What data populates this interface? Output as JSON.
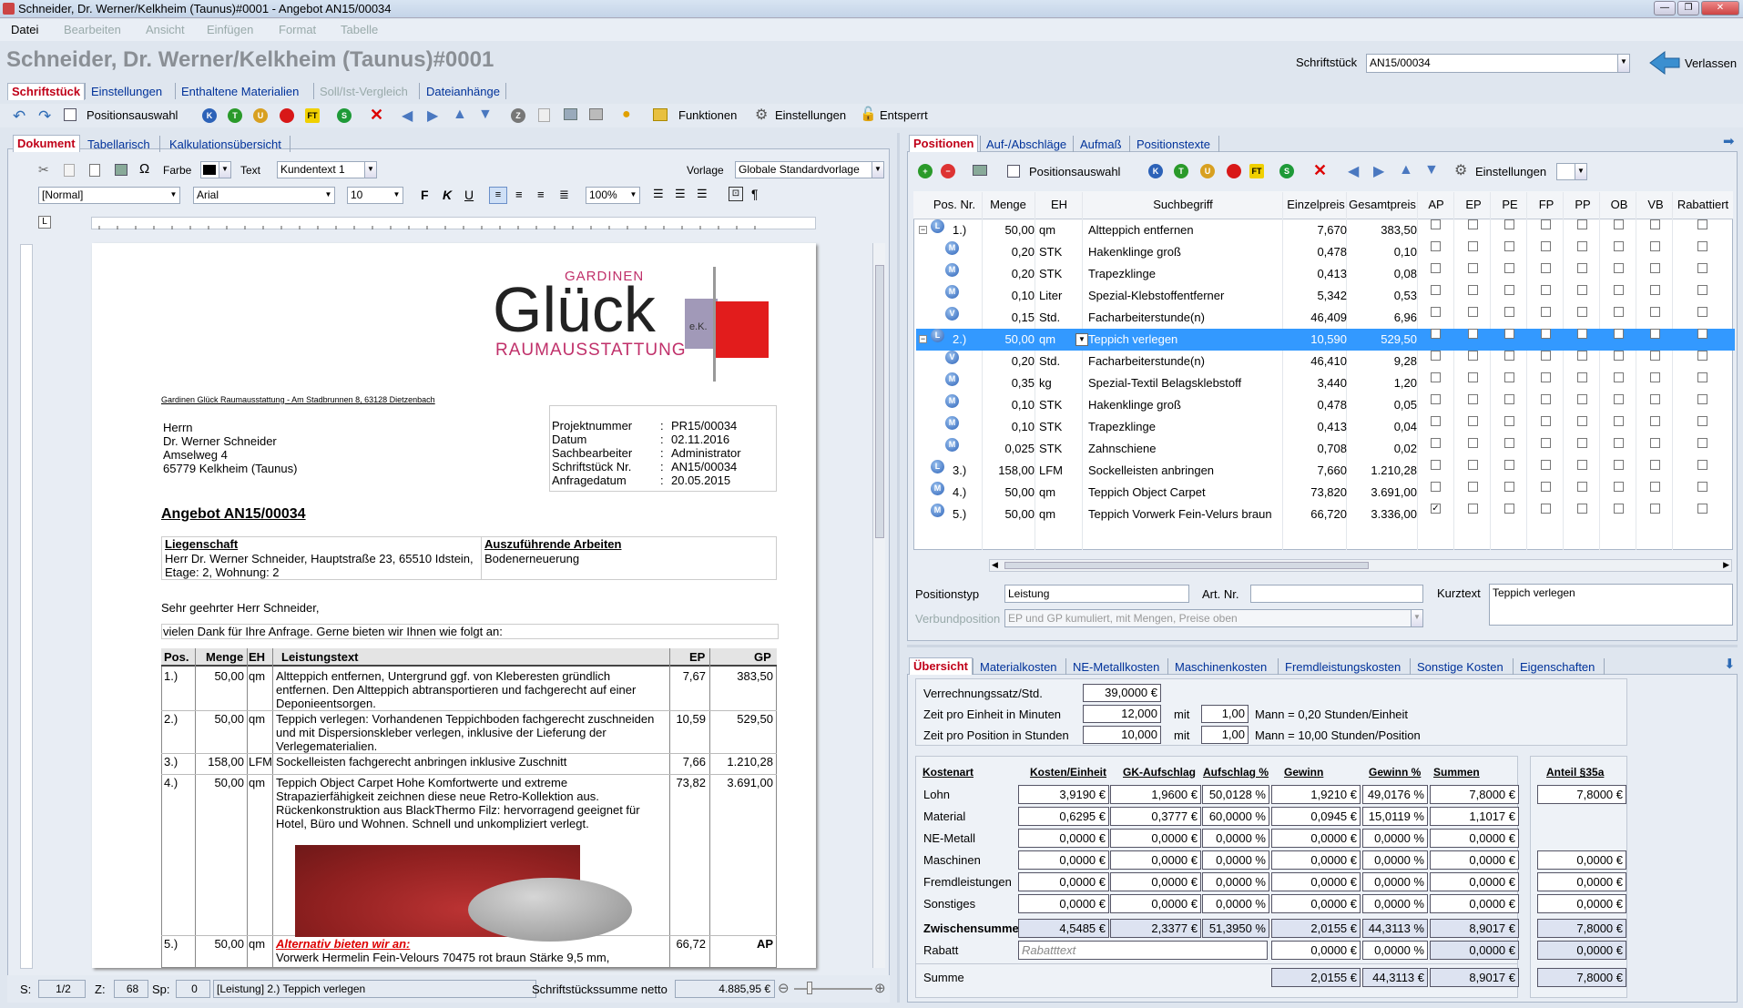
{
  "window": {
    "title": "Schneider, Dr. Werner/Kelkheim (Taunus)#0001 - Angebot AN15/00034"
  },
  "menu": [
    "Datei",
    "Bearbeiten",
    "Ansicht",
    "Einfügen",
    "Format",
    "Tabelle"
  ],
  "header": {
    "title": "Schneider, Dr. Werner/Kelkheim (Taunus)#0001",
    "schriftstueck_label": "Schriftstück",
    "schriftstueck_value": "AN15/00034",
    "verlassen": "Verlassen"
  },
  "main_tabs": [
    "Schriftstück",
    "Einstellungen",
    "Enthaltene Materialien",
    "Soll/Ist-Vergleich",
    "Dateianhänge"
  ],
  "toolbar": {
    "positionsauswahl": "Positionsauswahl",
    "funktionen": "Funktionen",
    "einstellungen": "Einstellungen",
    "entsperrt": "Entsperrt"
  },
  "doc_tabs": [
    "Dokument",
    "Tabellarisch",
    "Kalkulationsübersicht"
  ],
  "format": {
    "farbe": "Farbe",
    "text": "Text",
    "text_style": "Kundentext 1",
    "vorlage_label": "Vorlage",
    "vorlage": "Globale Standardvorlage",
    "style": "[Normal]",
    "font": "Arial",
    "size": "10",
    "zoom": "100%"
  },
  "document": {
    "logo_top": "GARDINEN",
    "logo_main": "Glück",
    "logo_ek": "e.K.",
    "logo_sub": "RAUMAUSSTATTUNG",
    "sender": "Gardinen Glück Raumausstattung - Am Stadbrunnen 8, 63128 Dietzenbach",
    "address": [
      "Herrn",
      "Dr. Werner Schneider",
      "Amselweg 4",
      "65779 Kelkheim (Taunus)"
    ],
    "meta_labels": [
      "Projektnummer",
      "Datum",
      "Sachbearbeiter",
      "Schriftstück Nr.",
      "Anfragedatum"
    ],
    "meta_values": [
      "PR15/00034",
      "02.11.2016",
      "Administrator",
      "AN15/00034",
      "20.05.2015"
    ],
    "heading": "Angebot AN15/00034",
    "liegenschaft_label": "Liegenschaft",
    "liegenschaft": "Herr Dr. Werner Schneider, Hauptstraße 23, 65510 Idstein, Etage: 2, Wohnung: 2",
    "arbeiten_label": "Auszuführende Arbeiten",
    "arbeiten": "Bodenerneuerung",
    "greeting": "Sehr geehrter Herr Schneider,",
    "intro": "vielen Dank für Ihre Anfrage. Gerne bieten wir Ihnen wie folgt an:",
    "cols": [
      "Pos.",
      "Menge",
      "EH",
      "Leistungstext",
      "EP",
      "GP"
    ],
    "rows": [
      {
        "pos": "1.)",
        "menge": "50,00",
        "eh": "qm",
        "text": "Altteppich entfernen, Untergrund ggf. von Kleberesten gründlich entfernen. Den Altteppich abtransportieren und fachgerecht auf einer Deponieentsorgen.",
        "ep": "7,67",
        "gp": "383,50"
      },
      {
        "pos": "2.)",
        "menge": "50,00",
        "eh": "qm",
        "text": "Teppich verlegen: Vorhandenen Teppichboden fachgerecht zuschneiden und mit Dispersionskleber verlegen, inklusive der Lieferung der Verlegematerialien.",
        "ep": "10,59",
        "gp": "529,50"
      },
      {
        "pos": "3.)",
        "menge": "158,00",
        "eh": "LFM",
        "text": "Sockelleisten fachgerecht anbringen inklusive Zuschnitt",
        "ep": "7,66",
        "gp": "1.210,28"
      },
      {
        "pos": "4.)",
        "menge": "50,00",
        "eh": "qm",
        "text": "Teppich Object Carpet  Hohe Komfortwerte und extreme Strapazierfähigkeit zeichnen diese neue Retro-Kollektion aus. Rückenkonstruktion aus BlackThermo Filz: hervorragend geeignet für Hotel, Büro und Wohnen. Schnell und unkompliziert verlegt.",
        "ep": "73,82",
        "gp": "3.691,00"
      },
      {
        "pos": "5.)",
        "menge": "50,00",
        "eh": "qm",
        "text": "Alternativ bieten wir an:",
        "text2": "Vorwerk Hermelin Fein-Velours 70475 rot braun Stärke 9,5 mm,",
        "ep": "66,72",
        "gp": "AP"
      }
    ]
  },
  "statusbar": {
    "s_label": "S:",
    "s": "1/2",
    "z_label": "Z:",
    "z": "68",
    "sp_label": "Sp:",
    "sp": "0",
    "info": "[Leistung]  2.) Teppich verlegen",
    "sum_label": "Schriftstückssumme netto",
    "sum": "4.885,95 €"
  },
  "right_tabs": [
    "Positionen",
    "Auf-/Abschläge",
    "Aufmaß",
    "Positionstexte"
  ],
  "right_toolbar": {
    "positionsauswahl": "Positionsauswahl",
    "einstellungen": "Einstellungen"
  },
  "grid": {
    "cols": [
      "Pos. Nr.",
      "Menge",
      "EH",
      "Suchbegriff",
      "Einzelpreis",
      "Gesamtpreis",
      "AP",
      "EP",
      "PE",
      "FP",
      "PP",
      "OB",
      "VB",
      "Rabattiert"
    ],
    "rows": [
      {
        "badge": "L",
        "pos": "1.)",
        "menge": "50,00",
        "eh": "qm",
        "such": "Altteppich entfernen",
        "ep": "7,670",
        "gp": "383,50",
        "ap": false,
        "lvl": 0
      },
      {
        "badge": "M",
        "pos": "",
        "menge": "0,20",
        "eh": "STK",
        "such": "Hakenklinge groß",
        "ep": "0,478",
        "gp": "0,10",
        "ap": false,
        "lvl": 1
      },
      {
        "badge": "M",
        "pos": "",
        "menge": "0,20",
        "eh": "STK",
        "such": "Trapezklinge",
        "ep": "0,413",
        "gp": "0,08",
        "ap": false,
        "lvl": 1
      },
      {
        "badge": "M",
        "pos": "",
        "menge": "0,10",
        "eh": "Liter",
        "such": "Spezial-Klebstoffentferner",
        "ep": "5,342",
        "gp": "0,53",
        "ap": false,
        "lvl": 1
      },
      {
        "badge": "V",
        "pos": "",
        "menge": "0,15",
        "eh": "Std.",
        "such": "Facharbeiterstunde(n)",
        "ep": "46,409",
        "gp": "6,96",
        "ap": false,
        "lvl": 1
      },
      {
        "badge": "L",
        "pos": "2.)",
        "menge": "50,00",
        "eh": "qm",
        "such": "Teppich verlegen",
        "ep": "10,590",
        "gp": "529,50",
        "ap": false,
        "lvl": 0,
        "sel": true
      },
      {
        "badge": "V",
        "pos": "",
        "menge": "0,20",
        "eh": "Std.",
        "such": "Facharbeiterstunde(n)",
        "ep": "46,410",
        "gp": "9,28",
        "ap": false,
        "lvl": 1
      },
      {
        "badge": "M",
        "pos": "",
        "menge": "0,35",
        "eh": "kg",
        "such": "Spezial-Textil Belagsklebstoff",
        "ep": "3,440",
        "gp": "1,20",
        "ap": false,
        "lvl": 1
      },
      {
        "badge": "M",
        "pos": "",
        "menge": "0,10",
        "eh": "STK",
        "such": "Hakenklinge groß",
        "ep": "0,478",
        "gp": "0,05",
        "ap": false,
        "lvl": 1
      },
      {
        "badge": "M",
        "pos": "",
        "menge": "0,10",
        "eh": "STK",
        "such": "Trapezklinge",
        "ep": "0,413",
        "gp": "0,04",
        "ap": false,
        "lvl": 1
      },
      {
        "badge": "M",
        "pos": "",
        "menge": "0,025",
        "eh": "STK",
        "such": "Zahnschiene",
        "ep": "0,708",
        "gp": "0,02",
        "ap": false,
        "lvl": 1
      },
      {
        "badge": "L",
        "pos": "3.)",
        "menge": "158,00",
        "eh": "LFM",
        "such": "Sockelleisten anbringen",
        "ep": "7,660",
        "gp": "1.210,28",
        "ap": false,
        "lvl": 0
      },
      {
        "badge": "M",
        "pos": "4.)",
        "menge": "50,00",
        "eh": "qm",
        "such": "Teppich Object Carpet",
        "ep": "73,820",
        "gp": "3.691,00",
        "ap": false,
        "lvl": 0
      },
      {
        "badge": "M",
        "pos": "5.)",
        "menge": "50,00",
        "eh": "qm",
        "such": "Teppich Vorwerk Fein-Velurs braun",
        "ep": "66,720",
        "gp": "3.336,00",
        "ap": true,
        "lvl": 0
      }
    ]
  },
  "posinfo": {
    "positionstyp_label": "Positionstyp",
    "positionstyp": "Leistung",
    "artnr_label": "Art. Nr.",
    "artnr": "",
    "kurztext_label": "Kurztext",
    "kurztext": "Teppich verlegen",
    "verbund_label": "Verbundposition",
    "verbund": "EP und GP kumuliert, mit Mengen, Preise oben"
  },
  "bottom_tabs": [
    "Übersicht",
    "Materialkosten",
    "NE-Metallkosten",
    "Maschinenkosten",
    "Fremdleistungskosten",
    "Sonstige Kosten",
    "Eigenschaften"
  ],
  "calc": {
    "vs_label": "Verrechnungssatz/Std.",
    "vs": "39,0000 €",
    "zeit1_label": "Zeit pro Einheit in Minuten",
    "zeit1": "12,000",
    "mit": "mit",
    "mann1": "1,00",
    "mann1_text": "Mann = 0,20 Stunden/Einheit",
    "zeit2_label": "Zeit pro Position in Stunden",
    "zeit2": "10,000",
    "mann2": "1,00",
    "mann2_text": "Mann = 10,00 Stunden/Position",
    "cols": [
      "Kostenart",
      "Kosten/Einheit",
      "GK-Aufschlag",
      "Aufschlag %",
      "Gewinn",
      "Gewinn %",
      "Summen",
      "Anteil §35a"
    ],
    "rows": [
      {
        "label": "Lohn",
        "v": [
          "3,9190 €",
          "1,9600 €",
          "50,0128 %",
          "1,9210 €",
          "49,0176 %",
          "7,8000 €"
        ],
        "a": "7,8000 €"
      },
      {
        "label": "Material",
        "v": [
          "0,6295 €",
          "0,3777 €",
          "60,0000 %",
          "0,0945 €",
          "15,0119 %",
          "1,1017 €"
        ],
        "a": ""
      },
      {
        "label": "NE-Metall",
        "v": [
          "0,0000 €",
          "0,0000 €",
          "0,0000 %",
          "0,0000 €",
          "0,0000 %",
          "0,0000 €"
        ],
        "a": ""
      },
      {
        "label": "Maschinen",
        "v": [
          "0,0000 €",
          "0,0000 €",
          "0,0000 %",
          "0,0000 €",
          "0,0000 %",
          "0,0000 €"
        ],
        "a": "0,0000 €"
      },
      {
        "label": "Fremdleistungen",
        "v": [
          "0,0000 €",
          "0,0000 €",
          "0,0000 %",
          "0,0000 €",
          "0,0000 %",
          "0,0000 €"
        ],
        "a": "0,0000 €"
      },
      {
        "label": "Sonstiges",
        "v": [
          "0,0000 €",
          "0,0000 €",
          "0,0000 %",
          "0,0000 €",
          "0,0000 %",
          "0,0000 €"
        ],
        "a": "0,0000 €"
      }
    ],
    "zw_label": "Zwischensumme",
    "zw": [
      "4,5485 €",
      "2,3377 €",
      "51,3950 %",
      "2,0155 €",
      "44,3113 %",
      "8,9017 €"
    ],
    "zw_a": "7,8000 €",
    "rabatt_label": "Rabatt",
    "rabatt_ph": "Rabatttext",
    "rabatt": [
      "0,0000 €",
      "0,0000 %",
      "0,0000 €"
    ],
    "rabatt_a": "0,0000 €",
    "summe_label": "Summe",
    "summe": [
      "2,0155 €",
      "44,3113 €",
      "8,9017 €"
    ],
    "summe_a": "7,8000 €"
  }
}
